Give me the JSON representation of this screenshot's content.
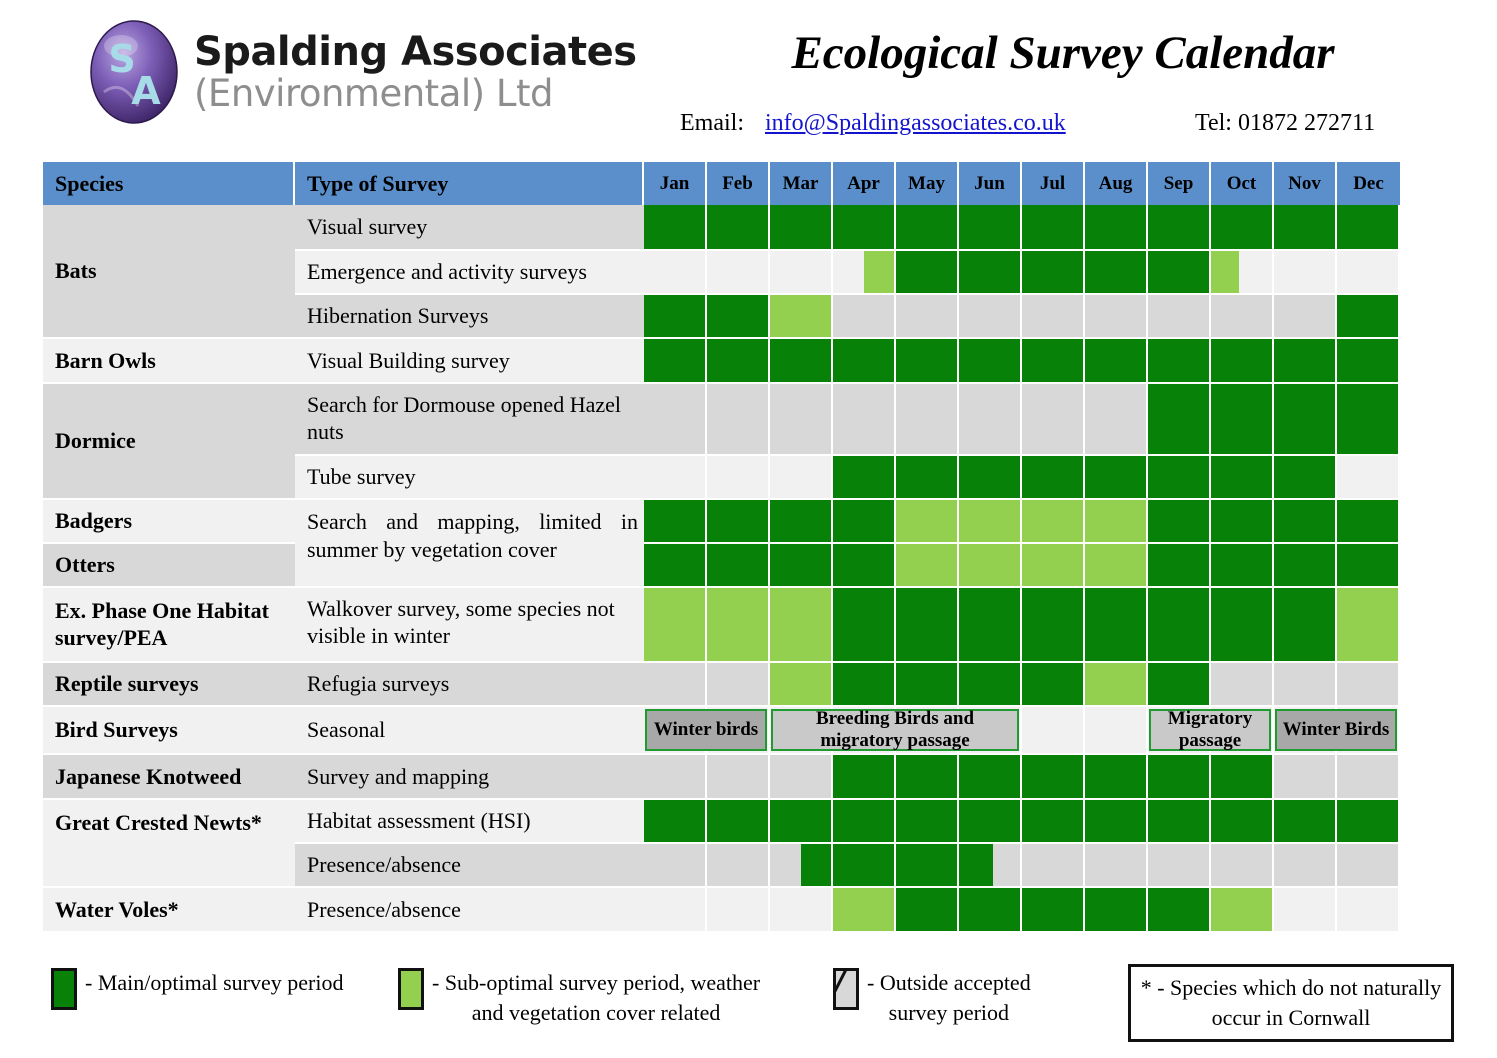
{
  "header": {
    "logo_initials": "SA",
    "company_line1": "Spalding Associates",
    "company_line2": "(Environmental) Ltd",
    "title": "Ecological Survey Calendar",
    "email_label": "Email:",
    "email": "info@Spaldingassociates.co.uk",
    "tel": "Tel: 01872 272711"
  },
  "table": {
    "columns": {
      "species": "Species",
      "type": "Type of Survey",
      "months": [
        "Jan",
        "Feb",
        "Mar",
        "Apr",
        "May",
        "Jun",
        "Jul",
        "Aug",
        "Sep",
        "Oct",
        "Nov",
        "Dec"
      ]
    },
    "species_groups": [
      {
        "label": "Bats",
        "shade": "a",
        "rows": 3
      },
      {
        "label": "Barn Owls",
        "shade": "b",
        "rows": 1
      },
      {
        "label": "Dormice",
        "shade": "a",
        "rows": 2
      },
      {
        "label": "Badgers",
        "shade": "b",
        "rows": 1
      },
      {
        "label": "Otters",
        "shade": "a",
        "rows": 1
      },
      {
        "label": "Ex. Phase One Habitat survey/PEA",
        "shade": "b",
        "rows": 1
      },
      {
        "label": "Reptile surveys",
        "shade": "a",
        "rows": 1
      },
      {
        "label": "Bird Surveys",
        "shade": "b",
        "rows": 1
      },
      {
        "label": "Japanese Knotweed",
        "shade": "a",
        "rows": 1
      },
      {
        "label": "Great Crested Newts*",
        "shade": "b",
        "rows": 2
      },
      {
        "label": "Water Voles*",
        "shade": "b",
        "rows": 1
      }
    ],
    "rows": [
      {
        "species": "Bats",
        "survey": "Visual survey",
        "row_shade": "a",
        "cells": [
          "dark",
          "dark",
          "dark",
          "dark",
          "dark",
          "dark",
          "dark",
          "dark",
          "dark",
          "dark",
          "dark",
          "dark"
        ]
      },
      {
        "species": "",
        "survey": "Emergence and activity surveys",
        "row_shade": "b",
        "cells": [
          "blank",
          "blank",
          "blank",
          "half-light-right",
          "dark",
          "dark",
          "dark",
          "dark",
          "dark",
          "half-light-left",
          "blank",
          "blank"
        ]
      },
      {
        "species": "",
        "survey": "Hibernation Surveys",
        "row_shade": "a",
        "cells": [
          "dark",
          "dark",
          "light",
          "grey",
          "grey",
          "grey",
          "grey",
          "grey",
          "grey",
          "grey",
          "grey",
          "dark"
        ]
      },
      {
        "species": "Barn Owls",
        "survey": "Visual Building survey",
        "row_shade": "b",
        "cells": [
          "dark",
          "dark",
          "dark",
          "dark",
          "dark",
          "dark",
          "dark",
          "dark",
          "dark",
          "dark",
          "dark",
          "dark"
        ]
      },
      {
        "species": "Dormice",
        "survey": "Search for Dormouse opened Hazel nuts",
        "row_shade": "a",
        "cells": [
          "grey",
          "grey",
          "grey",
          "grey",
          "grey",
          "grey",
          "grey",
          "grey",
          "dark",
          "dark",
          "dark",
          "dark"
        ]
      },
      {
        "species": "",
        "survey": "Tube survey",
        "row_shade": "b",
        "cells": [
          "blank",
          "blank",
          "blank",
          "dark",
          "dark",
          "dark",
          "dark",
          "dark",
          "dark",
          "dark",
          "dark",
          "blank"
        ]
      },
      {
        "species": "Badgers",
        "survey": "Search and mapping, limited in summer by vegetation cover",
        "row_shade": "b",
        "cells": [
          "dark",
          "dark",
          "dark",
          "dark",
          "light",
          "light",
          "light",
          "light",
          "dark",
          "dark",
          "dark",
          "dark"
        ]
      },
      {
        "species": "Otters",
        "survey": "",
        "row_shade": "a",
        "cells": [
          "dark",
          "dark",
          "dark",
          "dark",
          "light",
          "light",
          "light",
          "light",
          "dark",
          "dark",
          "dark",
          "dark"
        ]
      },
      {
        "species": "Ex. Phase One Habitat survey/PEA",
        "survey": "Walkover survey, some species not visible in winter",
        "row_shade": "b",
        "cells": [
          "light",
          "light",
          "light",
          "dark",
          "dark",
          "dark",
          "dark",
          "dark",
          "dark",
          "dark",
          "dark",
          "light"
        ]
      },
      {
        "species": "Reptile surveys",
        "survey": "Refugia surveys",
        "row_shade": "a",
        "cells": [
          "grey",
          "grey",
          "light",
          "dark",
          "dark",
          "dark",
          "dark",
          "light",
          "dark",
          "grey",
          "grey",
          "grey"
        ]
      },
      {
        "species": "Bird Surveys",
        "survey": "Seasonal",
        "row_shade": "b",
        "cells": [
          "band",
          "band",
          "band",
          "band",
          "band",
          "band",
          "blank",
          "blank",
          "band",
          "band",
          "band",
          "band"
        ],
        "bands": [
          {
            "label": "Winter birds",
            "start": 0,
            "span": 2,
            "tone": "dkgrey"
          },
          {
            "label": "Breeding Birds and migratory passage",
            "start": 2,
            "span": 4,
            "tone": "ltgrey"
          },
          {
            "label": "Migratory passage",
            "start": 8,
            "span": 2,
            "tone": "ltgrey"
          },
          {
            "label": "Winter Birds",
            "start": 10,
            "span": 2,
            "tone": "dkgrey"
          }
        ]
      },
      {
        "species": "Japanese Knotweed",
        "survey": "Survey and mapping",
        "row_shade": "a",
        "cells": [
          "grey",
          "grey",
          "grey",
          "dark",
          "dark",
          "dark",
          "dark",
          "dark",
          "dark",
          "dark",
          "grey",
          "grey"
        ]
      },
      {
        "species": "Great Crested Newts*",
        "survey": "Habitat assessment (HSI)",
        "row_shade": "b",
        "cells": [
          "dark",
          "dark",
          "dark",
          "dark",
          "dark",
          "dark",
          "dark",
          "dark",
          "dark",
          "dark",
          "dark",
          "dark"
        ]
      },
      {
        "species": "",
        "survey": "Presence/absence",
        "row_shade": "a",
        "cells": [
          "grey",
          "grey",
          "half-dark-right",
          "dark",
          "dark",
          "part-dark-left",
          "grey",
          "grey",
          "grey",
          "grey",
          "grey",
          "grey"
        ]
      },
      {
        "species": "Water Voles*",
        "survey": "Presence/absence",
        "row_shade": "b",
        "cells": [
          "blank",
          "blank",
          "blank",
          "light",
          "dark",
          "dark",
          "dark",
          "dark",
          "dark",
          "light",
          "blank",
          "blank"
        ]
      }
    ]
  },
  "legend": {
    "items": [
      {
        "swatch": "dark",
        "text": "- Main/optimal survey period",
        "text2": ""
      },
      {
        "swatch": "light",
        "text": "- Sub-optimal survey period, weather",
        "text2": "and vegetation cover related"
      },
      {
        "swatch": "outside",
        "text": "- Outside accepted",
        "text2": "survey period"
      }
    ],
    "note": "* - Species which do not naturally occur in Cornwall"
  },
  "colors": {
    "main": "#078107",
    "sub_optimal": "#93d04f",
    "outside": "#d8d8d8",
    "header_blue": "#5b8fcb",
    "band_border": "#1f9b2f",
    "link": "#1414cf"
  }
}
